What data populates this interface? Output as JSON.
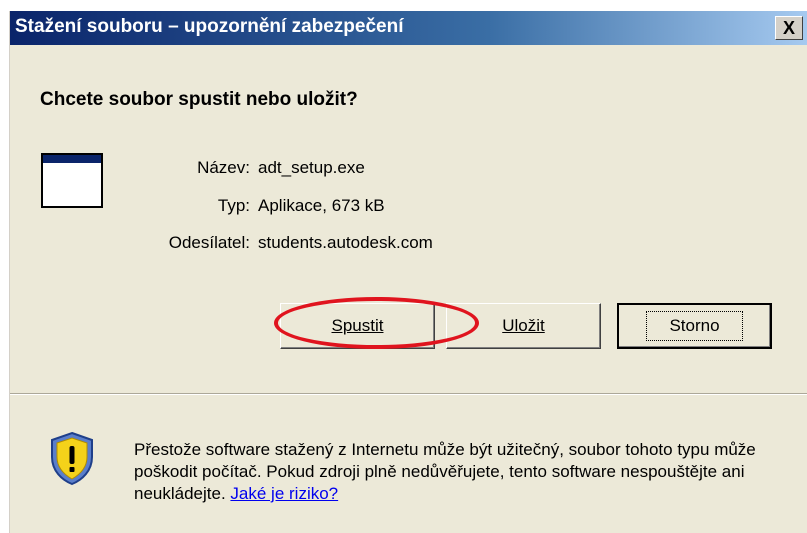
{
  "dialog": {
    "title": "Stažení souboru – upozornění zabezpečení",
    "close_label": "X",
    "question": "Chcete soubor spustit nebo uložit?"
  },
  "file": {
    "name_label": "Název:",
    "name_value": "adt_setup.exe",
    "type_label": "Typ:",
    "type_value": "Aplikace, 673 kB",
    "from_label": "Odesílatel:",
    "from_value": "students.autodesk.com",
    "icon": "application-window-icon"
  },
  "buttons": {
    "run_label": "Spustit",
    "save_label": "Uložit",
    "cancel_label": "Storno"
  },
  "warning": {
    "text": "Přestože software stažený z Internetu může být užitečný, soubor tohoto typu může poškodit počítač. Pokud zdroji plně nedůvěřujete, tento software nespouštějte ani neukládejte.",
    "link": "Jaké je riziko?",
    "icon": "security-shield-icon"
  },
  "colors": {
    "title_bar": "#0a246a",
    "highlight": "#e0141e",
    "link": "#0000ee"
  }
}
